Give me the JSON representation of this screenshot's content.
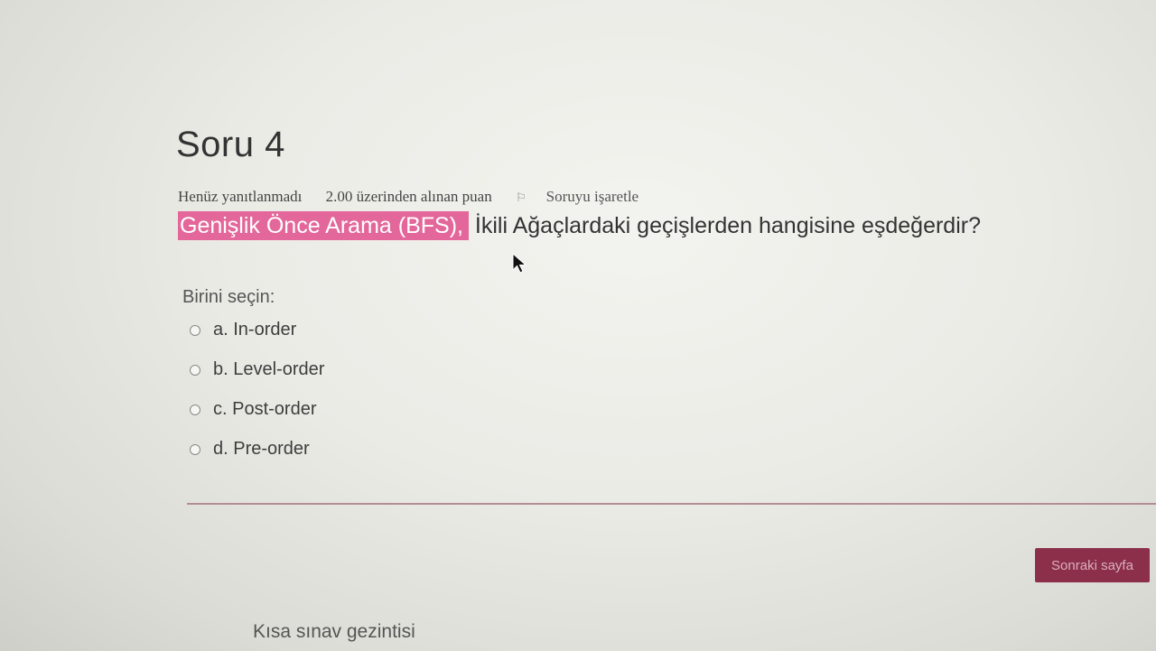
{
  "question": {
    "title": "Soru 4",
    "status": "Henüz yanıtlanmadı",
    "grade": "2.00 üzerinden alınan puan",
    "flag_label": "Soruyu işaretle",
    "text_highlighted": "Genişlik Önce Arama (BFS),",
    "text_rest": " İkili Ağaçlardaki geçişlerden hangisine eşdeğerdir?",
    "prompt": "Birini seçin:",
    "answers": [
      {
        "label": "a. In-order",
        "selected": false
      },
      {
        "label": "b. Level-order",
        "selected": false
      },
      {
        "label": "c. Post-order",
        "selected": false
      },
      {
        "label": "d. Pre-order",
        "selected": false
      }
    ]
  },
  "navigation": {
    "next_label": "Sonraki sayfa",
    "quiz_nav_title": "Kısa sınav gezintisi"
  },
  "colors": {
    "highlight": "#e3679a",
    "next_button": "#8c2f4a"
  },
  "icons": {
    "flag": "flag-icon",
    "cursor": "mouse-cursor-icon"
  }
}
